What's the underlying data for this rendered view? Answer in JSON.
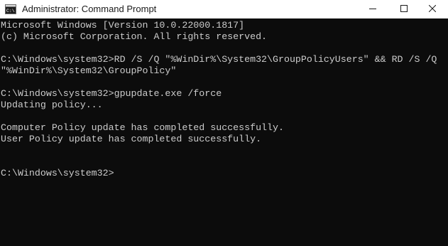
{
  "window": {
    "title": "Administrator: Command Prompt",
    "icon": "cmd-icon",
    "controls": [
      "minimize-icon",
      "maximize-icon",
      "close-icon"
    ]
  },
  "console": {
    "lines": [
      "Microsoft Windows [Version 10.0.22000.1817]",
      "(c) Microsoft Corporation. All rights reserved.",
      "",
      "C:\\Windows\\system32>RD /S /Q \"%WinDir%\\System32\\GroupPolicyUsers\" && RD /S /Q",
      "\"%WinDir%\\System32\\GroupPolicy\"",
      "",
      "C:\\Windows\\system32>gpupdate.exe /force",
      "Updating policy...",
      "",
      "Computer Policy update has completed successfully.",
      "User Policy update has completed successfully.",
      "",
      "",
      "C:\\Windows\\system32>"
    ]
  },
  "colors": {
    "console_background": "#0c0c0c",
    "console_text": "#cccccc",
    "titlebar_background": "#ffffff"
  }
}
